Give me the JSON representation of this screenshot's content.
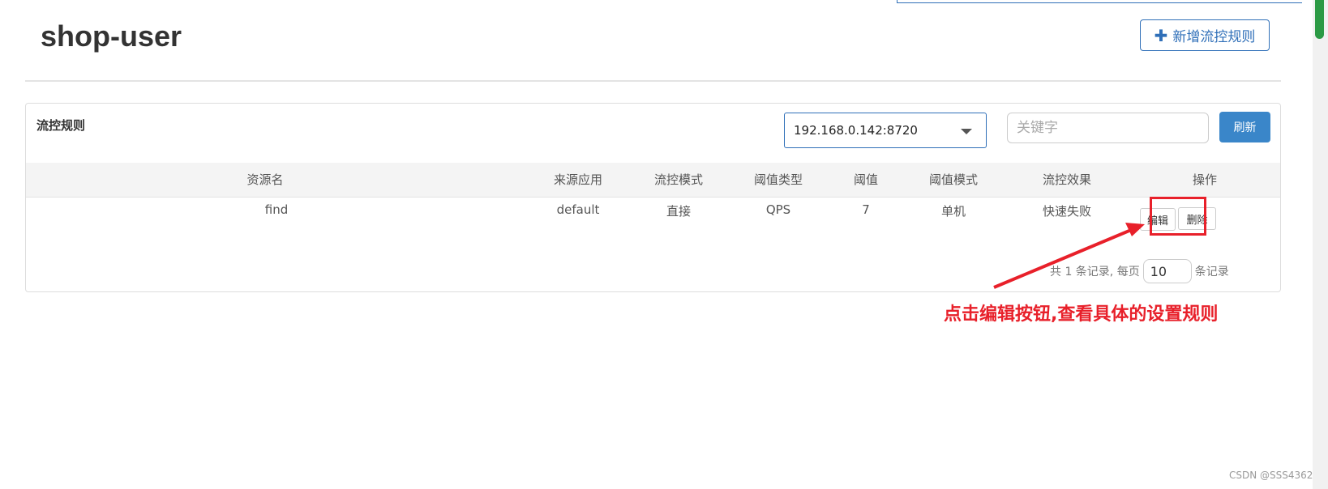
{
  "app": {
    "title": "shop-user",
    "add_button": "新增流控规则"
  },
  "panel": {
    "title": "流控规则",
    "ip_select": {
      "value": "192.168.0.142:8720"
    },
    "search": {
      "placeholder": "关键字"
    },
    "refresh_button": "刷新"
  },
  "table": {
    "columns": [
      "资源名",
      "来源应用",
      "流控模式",
      "阈值类型",
      "阈值",
      "阈值模式",
      "流控效果",
      "操作"
    ],
    "rows": [
      {
        "resource": "find",
        "origin": "default",
        "mode": "直接",
        "threshold_type": "QPS",
        "threshold": "7",
        "threshold_mode": "单机",
        "effect": "快速失败",
        "actions": {
          "edit": "编辑",
          "delete": "删除"
        }
      }
    ]
  },
  "pager": {
    "prefix": "共 1 条记录, 每页",
    "page_size": "10",
    "suffix": "条记录"
  },
  "annotation": "点击编辑按钮,查看具体的设置规则",
  "watermark": "CSDN @SSS4362",
  "colors": {
    "primary": "#2f6fb8",
    "refresh_bg": "#3a86c9",
    "annotation": "#e8202a"
  },
  "icons": {
    "add": "plus-icon",
    "select": "caret-down-icon"
  }
}
